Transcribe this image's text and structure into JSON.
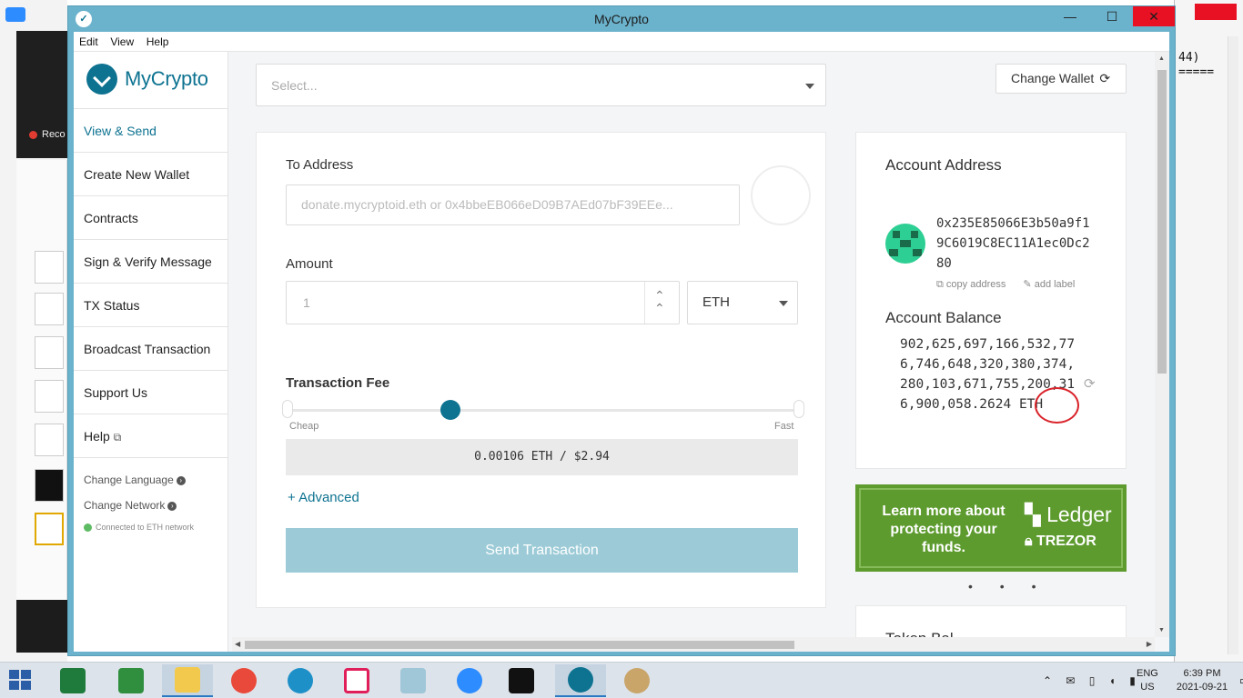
{
  "window": {
    "title": "MyCrypto",
    "minimize": "—",
    "maximize": "☐",
    "close": "✕"
  },
  "menu": [
    "Edit",
    "View",
    "Help"
  ],
  "sidebar": {
    "logo_text": "MyCrypto",
    "items": [
      {
        "label": "View & Send",
        "active": true
      },
      {
        "label": "Create New Wallet"
      },
      {
        "label": "Contracts"
      },
      {
        "label": "Sign & Verify Message"
      },
      {
        "label": "TX Status"
      },
      {
        "label": "Broadcast Transaction"
      },
      {
        "label": "Support Us"
      },
      {
        "label": "Help"
      }
    ],
    "change_language": "Change Language",
    "change_network": "Change Network",
    "network_status": "Connected to ETH network"
  },
  "node_select": {
    "placeholder": "Select..."
  },
  "change_wallet": {
    "label": "Change Wallet"
  },
  "send": {
    "to_label": "To Address",
    "to_placeholder": "donate.mycryptoid.eth or 0x4bbeEB066eD09B7AEd07bF39EEe...",
    "amount_label": "Amount",
    "amount_value": "1",
    "unit": "ETH",
    "fee_label": "Transaction Fee",
    "fee_cheap": "Cheap",
    "fee_fast": "Fast",
    "fee_level": 0.32,
    "fee_value": "0.00106 ETH / $2.94",
    "advanced": "+ Advanced",
    "send_button": "Send Transaction"
  },
  "account": {
    "address_heading": "Account Address",
    "address": "0x235E85066E3b50a9f19C6019C8EC11A1ec0Dc280",
    "copy_address": "copy address",
    "add_label": "add label",
    "balance_heading": "Account Balance",
    "balance": "902,625,697,166,532,776,746,648,320,380,374,280,103,671,755,200,316,900,058.2624 ETH"
  },
  "promo": {
    "text": "Learn more about protecting your funds.",
    "ledger": "Ledger",
    "trezor": "TREZOR"
  },
  "carousel_dots": "• • •",
  "token_heading": "Token Bal...",
  "background_terminal": "44)\n=====",
  "desktop": {
    "recording": "Reco"
  },
  "taskbar": {
    "language": "ENG",
    "region": "US",
    "time": "6:39 PM",
    "date": "2021-09-21"
  },
  "colors": {
    "brand": "#0e7391",
    "titlebar": "#6bb2cc",
    "send_disabled": "#9ccbd7",
    "promo_green": "#5d9b2e",
    "annotation_red": "#d9242b"
  }
}
